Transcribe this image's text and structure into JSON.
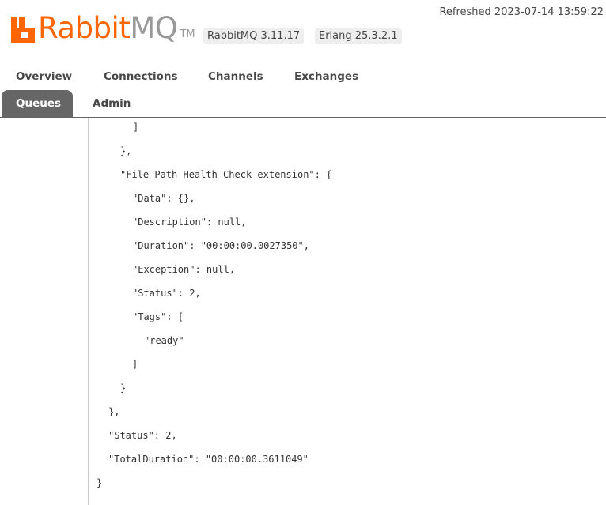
{
  "header": {
    "logo_word_main": "Rabbit",
    "logo_word_mq": "MQ",
    "logo_tm": "TM",
    "rabbitmq_version": "RabbitMQ 3.11.17",
    "erlang_version": "Erlang 25.3.2.1",
    "refreshed": "Refreshed 2023-07-14 13:59:22"
  },
  "nav": {
    "overview": "Overview",
    "connections": "Connections",
    "channels": "Channels",
    "exchanges": "Exchanges",
    "queues": "Queues",
    "admin": "Admin",
    "active": "Queues"
  },
  "json_lines": [
    "]",
    "},",
    "\"File Path Health Check extension\": {",
    "\"Data\": {},",
    "\"Description\": null,",
    "\"Duration\": \"00:00:00.0027350\",",
    "\"Exception\": null,",
    "\"Status\": 2,",
    "\"Tags\": [",
    "\"ready\"",
    "]",
    "}",
    "},",
    "\"Status\": 2,",
    "\"TotalDuration\": \"00:00:00.3611049\"",
    "}"
  ],
  "colors": {
    "brand_orange": "#ff6600",
    "active_tab_bg": "#666666"
  }
}
